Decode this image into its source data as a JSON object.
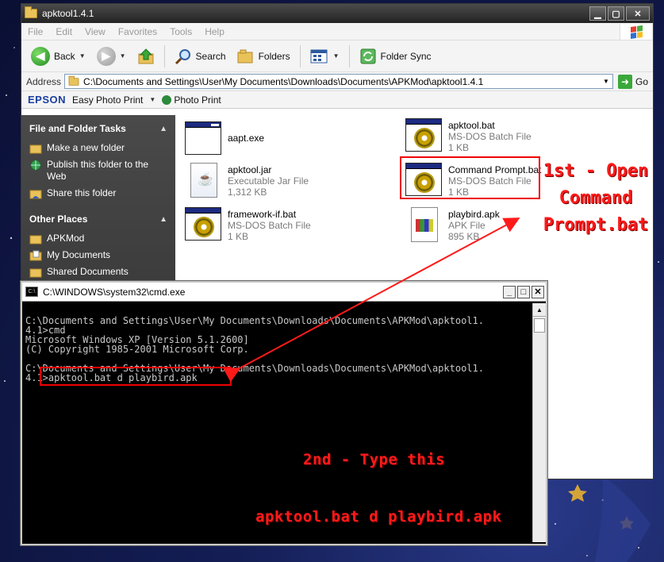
{
  "explorer": {
    "title": "apktool1.4.1",
    "menu": [
      "File",
      "Edit",
      "View",
      "Favorites",
      "Tools",
      "Help"
    ],
    "toolbar": {
      "back": "Back",
      "search": "Search",
      "folders": "Folders",
      "folder_sync": "Folder Sync"
    },
    "address": {
      "label": "Address",
      "value": "C:\\Documents and Settings\\User\\My Documents\\Downloads\\Documents\\APKMod\\apktool1.4.1",
      "go": "Go"
    },
    "epson": {
      "logo": "EPSON",
      "easy_photo_print": "Easy Photo Print",
      "photo_print": "Photo Print"
    },
    "left_pane": {
      "tasks_title": "File and Folder Tasks",
      "tasks": [
        "Make a new folder",
        "Publish this folder to the Web",
        "Share this folder"
      ],
      "places_title": "Other Places",
      "places": [
        "APKMod",
        "My Documents",
        "Shared Documents"
      ]
    },
    "files": [
      {
        "name": "aapt.exe",
        "type": "",
        "size": ""
      },
      {
        "name": "apktool.bat",
        "type": "MS-DOS Batch File",
        "size": "1 KB"
      },
      {
        "name": "apktool.jar",
        "type": "Executable Jar File",
        "size": "1,312 KB"
      },
      {
        "name": "Command Prompt.bat",
        "type": "MS-DOS Batch File",
        "size": "1 KB"
      },
      {
        "name": "framework-if.bat",
        "type": "MS-DOS Batch File",
        "size": "1 KB"
      },
      {
        "name": "playbird.apk",
        "type": "APK File",
        "size": "895 KB"
      }
    ]
  },
  "annotations": {
    "step1_line1": "1st - Open",
    "step1_line2": "Command",
    "step1_line3": "Prompt.bat",
    "step2_title": "2nd - Type this",
    "step2_command": "apktool.bat d playbird.apk"
  },
  "cmd": {
    "title": "C:\\WINDOWS\\system32\\cmd.exe",
    "lines": [
      "",
      "C:\\Documents and Settings\\User\\My Documents\\Downloads\\Documents\\APKMod\\apktool1.",
      "4.1>cmd",
      "Microsoft Windows XP [Version 5.1.2600]",
      "(C) Copyright 1985-2001 Microsoft Corp.",
      "",
      "C:\\Documents and Settings\\User\\My Documents\\Downloads\\Documents\\APKMod\\apktool1.",
      "4.1>apktool.bat d playbird.apk"
    ]
  },
  "colors": {
    "annotation_red": "#ff1a1a",
    "titlebar_dark": "#2a2a2a",
    "desktop_blue": "#141e55"
  }
}
